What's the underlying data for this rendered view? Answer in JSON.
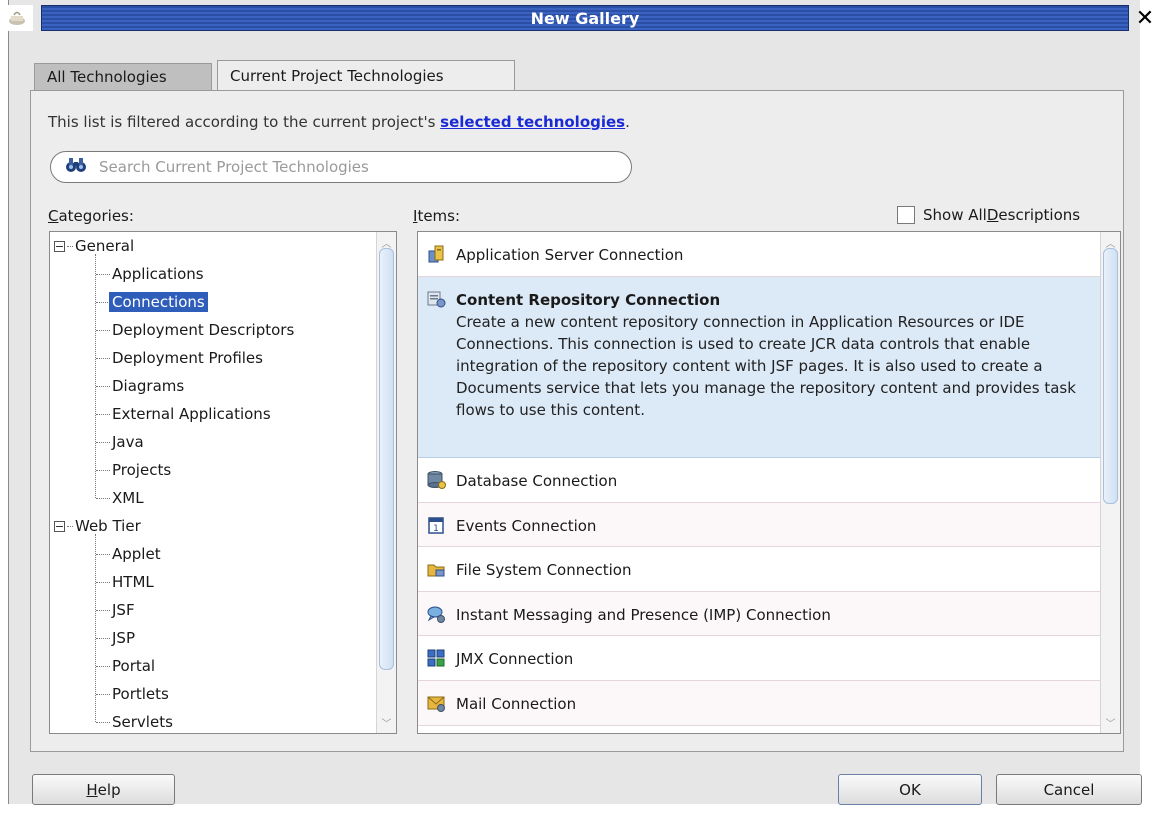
{
  "window": {
    "title": "New Gallery",
    "close_glyph": "✕"
  },
  "tabs": [
    {
      "label": "All Technologies",
      "active": false
    },
    {
      "label": "Current Project Technologies",
      "active": true
    }
  ],
  "filter": {
    "prefix": "This list is filtered according to the current project's ",
    "link": "selected technologies",
    "suffix": "."
  },
  "search": {
    "placeholder": "Search Current Project Technologies",
    "value": ""
  },
  "categories": {
    "label_mnemonic": "C",
    "label_rest": "ategories:",
    "nodes": [
      {
        "label": "General",
        "level": 0,
        "expanded": true
      },
      {
        "label": "Applications",
        "level": 1
      },
      {
        "label": "Connections",
        "level": 1,
        "selected": true
      },
      {
        "label": "Deployment Descriptors",
        "level": 1
      },
      {
        "label": "Deployment Profiles",
        "level": 1
      },
      {
        "label": "Diagrams",
        "level": 1
      },
      {
        "label": "External Applications",
        "level": 1
      },
      {
        "label": "Java",
        "level": 1
      },
      {
        "label": "Projects",
        "level": 1
      },
      {
        "label": "XML",
        "level": 1
      },
      {
        "label": "Web Tier",
        "level": 0,
        "expanded": true
      },
      {
        "label": "Applet",
        "level": 1
      },
      {
        "label": "HTML",
        "level": 1
      },
      {
        "label": "JSF",
        "level": 1
      },
      {
        "label": "JSP",
        "level": 1
      },
      {
        "label": "Portal",
        "level": 1
      },
      {
        "label": "Portlets",
        "level": 1
      },
      {
        "label": "Servlets",
        "level": 1
      }
    ]
  },
  "items": {
    "label_mnemonic": "I",
    "label_rest": "tems:",
    "show_all_prefix": "Show All ",
    "show_all_mnemonic": "D",
    "show_all_rest": "escriptions",
    "show_all_checked": false,
    "list": [
      {
        "title": "Application Server Connection",
        "icon": "server-icon"
      },
      {
        "title": "Content Repository Connection",
        "icon": "repository-icon",
        "selected": true,
        "description": "Create a new content repository connection in Application Resources or IDE Connections. This connection is used to create JCR data controls that enable integration of the repository content with JSF pages. It is also used to create a Documents service that lets you manage the repository content and provides task flows to use this content."
      },
      {
        "title": "Database Connection",
        "icon": "database-icon"
      },
      {
        "title": "Events Connection",
        "icon": "calendar-icon"
      },
      {
        "title": "File System Connection",
        "icon": "folder-icon"
      },
      {
        "title": "Instant Messaging and Presence (IMP) Connection",
        "icon": "chat-icon"
      },
      {
        "title": "JMX Connection",
        "icon": "jmx-icon"
      },
      {
        "title": "Mail Connection",
        "icon": "mail-icon"
      }
    ]
  },
  "buttons": {
    "help_mnemonic": "H",
    "help_rest": "elp",
    "ok": "OK",
    "cancel": "Cancel"
  }
}
